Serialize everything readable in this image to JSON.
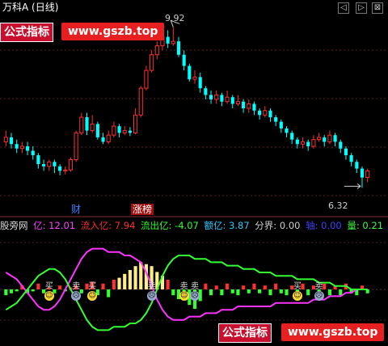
{
  "title": "万科A (日线)",
  "controls": {
    "prev": "◁",
    "next": "▷",
    "close": "⊠"
  },
  "watermark_top": {
    "label": "公式指标",
    "url": "www.gszb.top"
  },
  "watermark_bottom": {
    "label": "公式指标",
    "url": "www.gszb.top"
  },
  "price_high_label": "9.92",
  "price_low_label": "6.32",
  "tags": {
    "cai": "财",
    "zhangbang": "涨榜"
  },
  "indicator": {
    "name": "股旁网",
    "fields": [
      {
        "label": "亿:",
        "value": "12.01",
        "color": "#ff44ff"
      },
      {
        "label": "流入亿:",
        "value": "7.94",
        "color": "#ff3030"
      },
      {
        "label": "流出亿:",
        "value": "-4.07",
        "color": "#30ff30"
      },
      {
        "label": "额亿:",
        "value": "3.87",
        "color": "#30c8ff"
      },
      {
        "label": "分界:",
        "value": "0.00",
        "color": "#d0d0d0"
      },
      {
        "label": "轴:",
        "value": "0.00",
        "color": "#4040ff"
      },
      {
        "label": "量:",
        "value": "0.21",
        "color": "#40ff40"
      }
    ]
  },
  "signals": {
    "buy": "买",
    "sell": "卖"
  },
  "colors": {
    "up": "#ff3030",
    "down": "#00ffff",
    "pink": "#ff33ff",
    "green": "#33ff33",
    "yellow": "#ffee88"
  },
  "chart_data": [
    {
      "type": "candlestick",
      "title": "万科A (日线)",
      "ylim": [
        6.0,
        10.2
      ],
      "candles": [
        [
          7.35,
          7.45,
          7.6,
          7.25
        ],
        [
          7.45,
          7.3,
          7.55,
          7.2
        ],
        [
          7.3,
          7.2,
          7.4,
          7.1
        ],
        [
          7.2,
          7.25,
          7.35,
          7.1
        ],
        [
          7.25,
          7.15,
          7.35,
          7.05
        ],
        [
          7.15,
          7.05,
          7.25,
          6.95
        ],
        [
          7.05,
          6.85,
          7.1,
          6.75
        ],
        [
          6.85,
          6.8,
          6.95,
          6.7
        ],
        [
          6.8,
          6.9,
          6.95,
          6.7
        ],
        [
          6.9,
          6.8,
          6.95,
          6.65
        ],
        [
          6.8,
          6.7,
          6.85,
          6.6
        ],
        [
          6.7,
          6.72,
          6.8,
          6.62
        ],
        [
          6.72,
          6.95,
          7.0,
          6.68
        ],
        [
          6.95,
          7.55,
          7.6,
          6.9
        ],
        [
          7.55,
          7.9,
          8.0,
          7.5
        ],
        [
          7.9,
          7.6,
          8.0,
          7.5
        ],
        [
          7.6,
          7.75,
          7.95,
          7.55
        ],
        [
          7.75,
          7.45,
          7.8,
          7.4
        ],
        [
          7.45,
          7.35,
          7.55,
          7.3
        ],
        [
          7.35,
          7.5,
          7.6,
          7.3
        ],
        [
          7.5,
          7.7,
          7.8,
          7.45
        ],
        [
          7.7,
          7.55,
          7.75,
          7.45
        ],
        [
          7.55,
          7.6,
          7.7,
          7.5
        ],
        [
          7.6,
          7.55,
          7.68,
          7.48
        ],
        [
          7.55,
          7.95,
          8.1,
          7.52
        ],
        [
          7.95,
          8.55,
          8.6,
          7.9
        ],
        [
          8.55,
          8.95,
          9.05,
          8.5
        ],
        [
          8.95,
          9.3,
          9.4,
          8.9
        ],
        [
          9.3,
          9.5,
          9.6,
          9.2
        ],
        [
          9.5,
          9.7,
          9.8,
          9.4
        ],
        [
          9.7,
          9.55,
          9.85,
          9.45
        ],
        [
          9.55,
          9.6,
          9.92,
          9.5
        ],
        [
          9.6,
          9.3,
          9.7,
          9.25
        ],
        [
          9.3,
          9.05,
          9.4,
          8.95
        ],
        [
          9.05,
          8.75,
          9.1,
          8.7
        ],
        [
          8.75,
          8.8,
          8.95,
          8.65
        ],
        [
          8.8,
          8.55,
          8.9,
          8.45
        ],
        [
          8.55,
          8.4,
          8.6,
          8.3
        ],
        [
          8.4,
          8.3,
          8.5,
          8.2
        ],
        [
          8.3,
          8.4,
          8.5,
          8.2
        ],
        [
          8.4,
          8.25,
          8.45,
          8.15
        ],
        [
          8.25,
          8.35,
          8.5,
          8.2
        ],
        [
          8.35,
          8.2,
          8.4,
          8.1
        ],
        [
          8.2,
          8.25,
          8.4,
          8.15
        ],
        [
          8.25,
          8.1,
          8.3,
          8.0
        ],
        [
          8.1,
          8.2,
          8.3,
          8.0
        ],
        [
          8.2,
          8.05,
          8.25,
          7.95
        ],
        [
          8.05,
          7.95,
          8.1,
          7.85
        ],
        [
          7.95,
          8.05,
          8.15,
          7.9
        ],
        [
          8.05,
          7.9,
          8.1,
          7.8
        ],
        [
          7.9,
          7.8,
          7.95,
          7.7
        ],
        [
          7.8,
          7.65,
          7.85,
          7.55
        ],
        [
          7.65,
          7.55,
          7.7,
          7.45
        ],
        [
          7.55,
          7.4,
          7.6,
          7.3
        ],
        [
          7.4,
          7.3,
          7.45,
          7.2
        ],
        [
          7.3,
          7.35,
          7.45,
          7.2
        ],
        [
          7.35,
          7.25,
          7.4,
          7.15
        ],
        [
          7.25,
          7.4,
          7.5,
          7.2
        ],
        [
          7.4,
          7.45,
          7.55,
          7.35
        ],
        [
          7.45,
          7.35,
          7.5,
          7.25
        ],
        [
          7.35,
          7.5,
          7.6,
          7.3
        ],
        [
          7.5,
          7.35,
          7.55,
          7.25
        ],
        [
          7.35,
          7.2,
          7.4,
          7.1
        ],
        [
          7.2,
          7.05,
          7.25,
          6.95
        ],
        [
          7.05,
          6.9,
          7.1,
          6.8
        ],
        [
          6.9,
          6.75,
          6.95,
          6.65
        ],
        [
          6.75,
          6.55,
          6.8,
          6.32
        ],
        [
          6.55,
          6.7,
          6.75,
          6.45
        ]
      ]
    },
    {
      "type": "bar+line",
      "title": "股旁网",
      "bars": [
        -3,
        -2,
        -1,
        2,
        -2,
        -1,
        3,
        -2,
        1,
        -2,
        2,
        -1,
        1,
        2,
        -2,
        3,
        4,
        -3,
        3,
        -4,
        5,
        6,
        8,
        10,
        12,
        14,
        13,
        12,
        9,
        7,
        5,
        -3,
        -5,
        -4,
        -8,
        -10,
        -6,
        3,
        -3,
        2,
        -3,
        3,
        -2,
        -3,
        2,
        -2,
        3,
        -2,
        2,
        -3,
        3,
        -2,
        -3,
        2,
        -2,
        3,
        -3,
        2,
        -2,
        3,
        -3,
        2,
        -3,
        3,
        -2,
        -3,
        2,
        -2
      ],
      "pink_line": [
        5,
        4,
        3,
        1,
        -1,
        -3,
        -5,
        -6,
        -6,
        -5,
        -3,
        0,
        3,
        6,
        9,
        11,
        12,
        12,
        12,
        11,
        11,
        11,
        10,
        10,
        9,
        8,
        5,
        1,
        -3,
        -6,
        -8,
        -9,
        -9,
        -9,
        -8,
        -8,
        -8,
        -7,
        -7,
        -7,
        -6,
        -6,
        -6,
        -5,
        -5,
        -5,
        -5,
        -5,
        -5,
        -5,
        -4,
        -4,
        -4,
        -4,
        -4,
        -4,
        -4,
        -3,
        -3,
        -3,
        -2,
        -2,
        -2,
        -1,
        -1,
        0,
        0,
        0
      ],
      "green_line": [
        -6,
        -5,
        -4,
        -2,
        0,
        2,
        4,
        5,
        6,
        6,
        5,
        3,
        0,
        -3,
        -6,
        -9,
        -11,
        -12,
        -12,
        -12,
        -11,
        -11,
        -11,
        -10,
        -10,
        -9,
        -7,
        -4,
        0,
        4,
        7,
        9,
        10,
        10,
        10,
        9,
        9,
        9,
        8,
        8,
        8,
        7,
        7,
        7,
        6,
        6,
        6,
        5,
        5,
        5,
        4,
        4,
        4,
        4,
        3,
        3,
        3,
        3,
        2,
        2,
        2,
        1,
        1,
        1,
        0,
        0,
        0,
        0
      ],
      "signals": [
        {
          "i": 8,
          "kind": "buy",
          "face": "smile"
        },
        {
          "i": 13,
          "kind": "sell",
          "face": "sad"
        },
        {
          "i": 16,
          "kind": "buy",
          "face": "smile"
        },
        {
          "i": 27,
          "kind": "sell",
          "face": "sad"
        },
        {
          "i": 33,
          "kind": "sell",
          "face": "smile"
        },
        {
          "i": 35,
          "kind": "sell",
          "face": "sad"
        },
        {
          "i": 54,
          "kind": "buy",
          "face": "smile"
        },
        {
          "i": 58,
          "kind": "sell",
          "face": "sad"
        }
      ]
    }
  ]
}
